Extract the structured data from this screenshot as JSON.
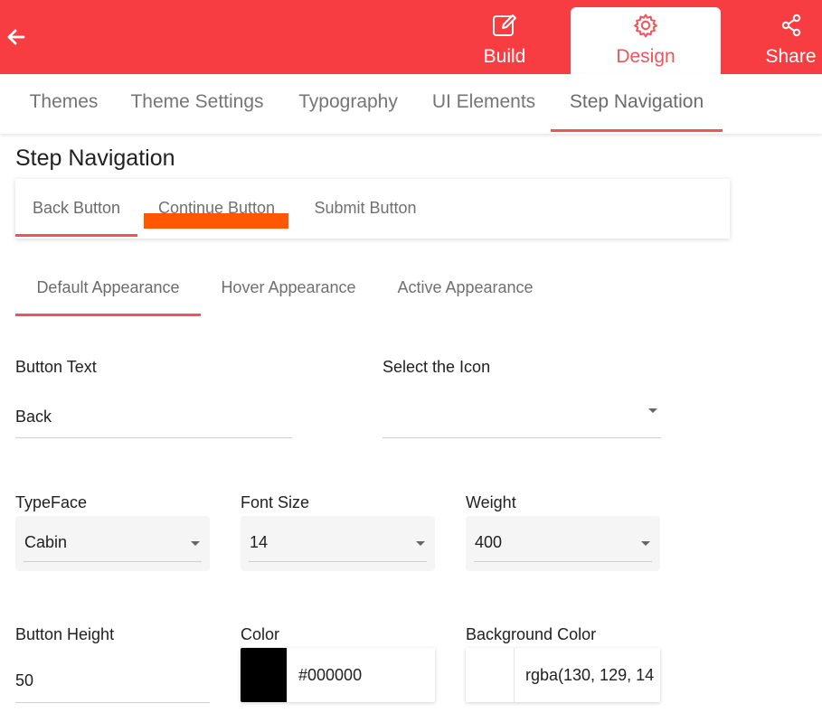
{
  "header": {
    "back_icon": "arrow-left-icon",
    "nav": [
      {
        "label": "Build",
        "icon": "edit-icon"
      },
      {
        "label": "Design",
        "icon": "gear-icon"
      },
      {
        "label": "Share",
        "icon": "share-icon"
      }
    ],
    "active_nav": "Design",
    "bg_color": "#f73d42",
    "accent_color": "#f05458"
  },
  "main_tabs": [
    {
      "label": "Themes"
    },
    {
      "label": "Theme Settings"
    },
    {
      "label": "Typography"
    },
    {
      "label": "UI Elements"
    },
    {
      "label": "Step Navigation"
    }
  ],
  "active_main_tab": "Step Navigation",
  "section_title": "Step Navigation",
  "sub_tabs": [
    {
      "label": "Back Button"
    },
    {
      "label": "Continue Button"
    },
    {
      "label": "Submit Button"
    }
  ],
  "active_sub_tab": "Back Button",
  "appearance_tabs": [
    {
      "label": "Default Appearance"
    },
    {
      "label": "Hover Appearance"
    },
    {
      "label": "Active Appearance"
    }
  ],
  "active_appearance_tab": "Default Appearance",
  "form": {
    "button_text": {
      "label": "Button Text",
      "value": "Back"
    },
    "select_icon": {
      "label": "Select the Icon",
      "value": ""
    },
    "typeface": {
      "label": "TypeFace",
      "value": "Cabin"
    },
    "font_size": {
      "label": "Font Size",
      "value": "14"
    },
    "weight": {
      "label": "Weight",
      "value": "400"
    },
    "button_height": {
      "label": "Button Height",
      "value": "50"
    },
    "color": {
      "label": "Color",
      "value": "#000000",
      "swatch": "#000000"
    },
    "background_color": {
      "label": "Background Color",
      "value": "rgba(130, 129, 14",
      "swatch": "#ffffff"
    }
  },
  "annotation_color": "#ff5800"
}
